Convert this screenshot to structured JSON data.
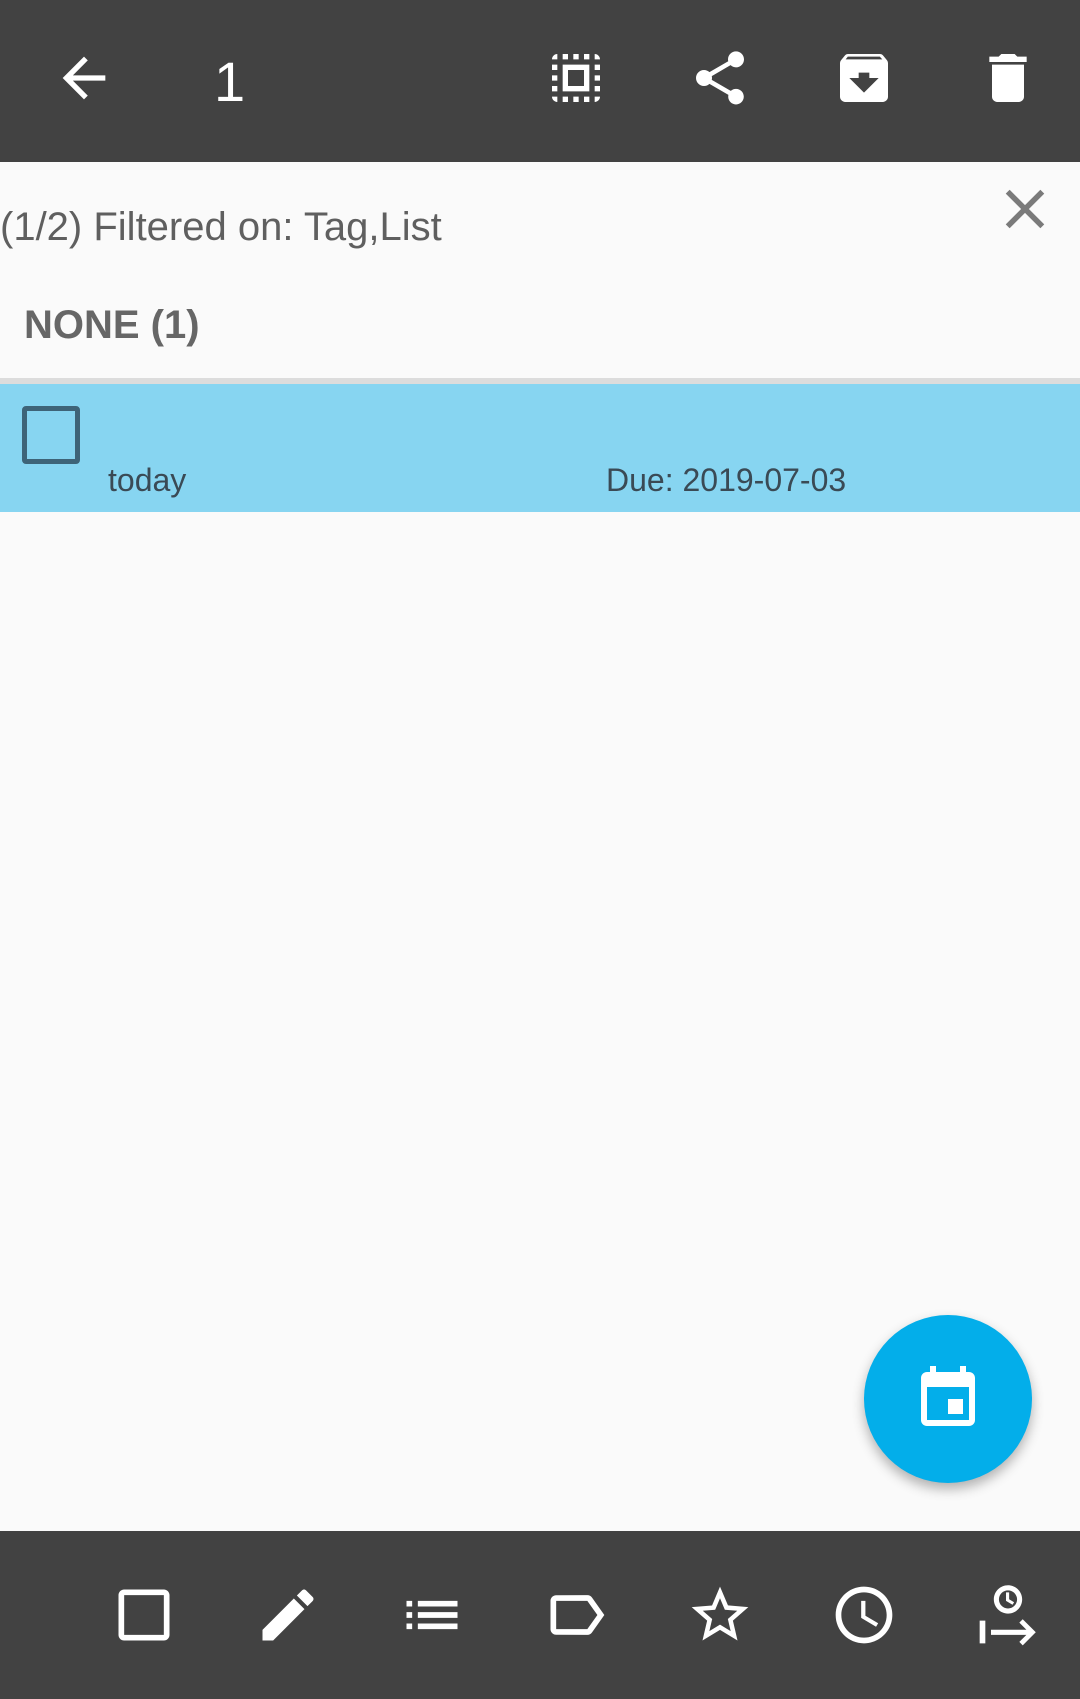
{
  "toolbar": {
    "selected_count": "1",
    "icons": [
      "back-arrow-icon",
      "select-all-icon",
      "share-icon",
      "archive-icon",
      "delete-icon"
    ]
  },
  "filter": {
    "text": "(1/2) Filtered on: Tag,List"
  },
  "group": {
    "header": "NONE (1)"
  },
  "tasks": [
    {
      "date_label": "today",
      "due_label": "Due: 2019-07-03",
      "selected": true
    }
  ],
  "fab": {
    "icon": "calendar-icon",
    "color": "#03aeea"
  },
  "bottom_toolbar": {
    "icons": [
      "checkbox-icon",
      "edit-icon",
      "list-icon",
      "tag-icon",
      "star-icon",
      "clock-icon",
      "threshold-date-icon"
    ]
  },
  "colors": {
    "toolbar": "#424242",
    "selected_row": "#87d5f1",
    "background": "#fafafa"
  }
}
